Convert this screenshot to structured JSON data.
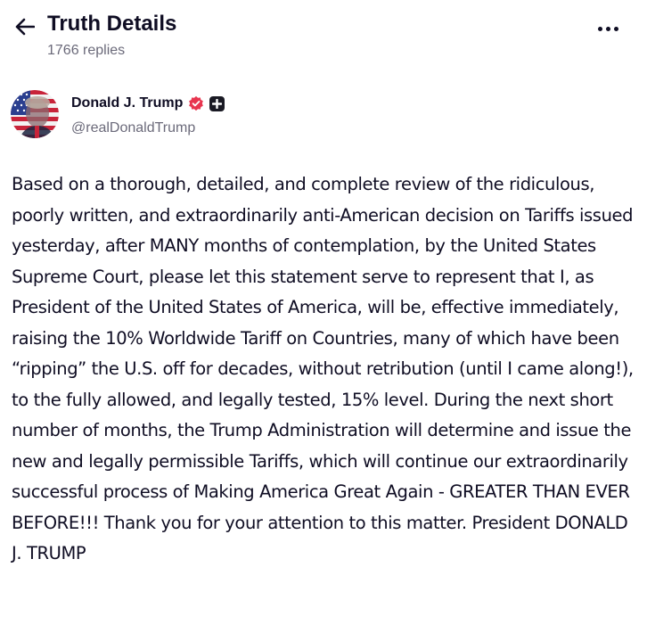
{
  "header": {
    "back_icon": "arrow-left-icon",
    "title": "Truth Details",
    "reply_count": "1766 replies",
    "more_icon": "more-horizontal-icon"
  },
  "author": {
    "avatar": "avatar-flag-portrait",
    "name": "Donald J. Trump",
    "verified_icon": "verified-badge-icon",
    "verified_color": "#e8354f",
    "plus_icon": "plus-badge-icon",
    "handle": "@realDonaldTrump"
  },
  "post": {
    "text": "Based on a thorough, detailed, and complete review of the ridiculous, poorly written, and extraordinarily anti-American decision on Tariffs issued yesterday, after MANY months of contemplation, by the United States Supreme Court, please let this statement serve to represent that I, as President of the United States of America, will be, effective immediately, raising the 10% Worldwide Tariff on Countries, many of which have been “ripping” the U.S. off for decades, without retribution (until I came along!), to the fully allowed, and legally tested, 15% level. During the next short number of months, the Trump Administration will determine and issue the new and legally permissible Tariffs, which will continue our extraordinarily successful process of Making America Great Again - GREATER THAN EVER BEFORE!!! Thank you for your attention to this matter. President DONALD J. TRUMP"
  },
  "colors": {
    "text": "#0f0d23",
    "muted": "#6b6a7a",
    "background": "#ffffff"
  }
}
